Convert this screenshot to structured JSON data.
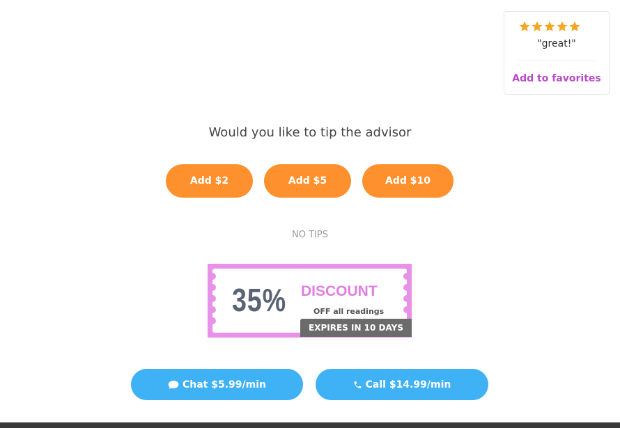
{
  "review": {
    "stars": 5,
    "max_stars": 5,
    "quote": "\"great!\"",
    "favorites_label": "Add to favorites"
  },
  "tip": {
    "title": "Would you like to tip the advisor",
    "options": [
      "Add $2",
      "Add $5",
      "Add $10"
    ],
    "no_tips_label": "NO TIPS"
  },
  "coupon": {
    "percent": "35%",
    "discount": "DISCOUNT",
    "subtitle": "OFF all readings",
    "expires": "EXPIRES IN 10 DAYS"
  },
  "actions": {
    "chat_label": "Chat $5.99/min",
    "call_label": "Call $14.99/min"
  },
  "colors": {
    "tip_button": "#fe912e",
    "cta_button": "#3fb1f5",
    "favorites_link": "#b94ac8",
    "star": "#f5a623",
    "coupon_border": "#e891e8"
  },
  "icons": {
    "star": "star-icon",
    "chat": "chat-bubble-icon",
    "call": "phone-icon"
  }
}
